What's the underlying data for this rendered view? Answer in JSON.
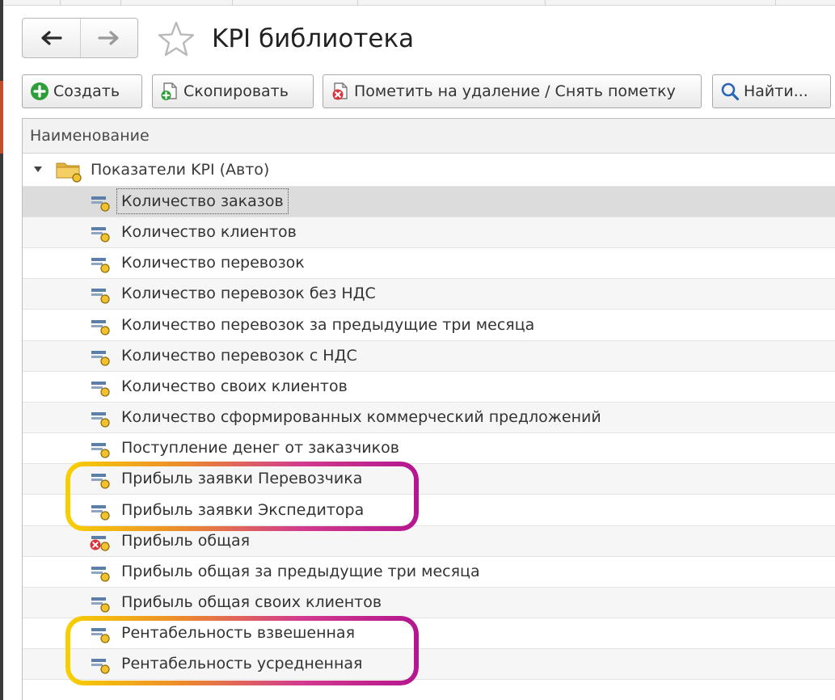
{
  "window": {
    "title": "KPI библиотека",
    "favorite_icon": "star-outline-icon",
    "nav": {
      "back_icon": "arrow-left-icon",
      "forward_icon": "arrow-right-icon"
    }
  },
  "toolbar": {
    "create_label": "Создать",
    "create_icon": "plus-circle-icon",
    "copy_label": "Скопировать",
    "copy_icon": "copy-document-icon",
    "mark_delete_label": "Пометить на удаление / Снять пометку",
    "mark_delete_icon": "delete-mark-icon",
    "find_label": "Найти..."
  },
  "table": {
    "column_name": "Наименование",
    "group": {
      "label": "Показатели KPI (Авто)",
      "icon": "folder-icon",
      "expanded": true
    },
    "items": [
      {
        "label": "Количество заказов",
        "selected": true,
        "marked_for_deletion": false
      },
      {
        "label": "Количество клиентов",
        "selected": false,
        "marked_for_deletion": false
      },
      {
        "label": "Количество перевозок",
        "selected": false,
        "marked_for_deletion": false
      },
      {
        "label": "Количество перевозок без НДС",
        "selected": false,
        "marked_for_deletion": false
      },
      {
        "label": "Количество перевозок за предыдущие три месяца",
        "selected": false,
        "marked_for_deletion": false
      },
      {
        "label": "Количество перевозок с НДС",
        "selected": false,
        "marked_for_deletion": false
      },
      {
        "label": "Количество своих клиентов",
        "selected": false,
        "marked_for_deletion": false
      },
      {
        "label": "Количество сформированных коммерческий предложений",
        "selected": false,
        "marked_for_deletion": false
      },
      {
        "label": "Поступление денег от заказчиков",
        "selected": false,
        "marked_for_deletion": false
      },
      {
        "label": "Прибыль заявки Перевозчика",
        "selected": false,
        "marked_for_deletion": false,
        "highlighted": true
      },
      {
        "label": "Прибыль заявки Экспедитора",
        "selected": false,
        "marked_for_deletion": false,
        "highlighted": true
      },
      {
        "label": "Прибыль общая",
        "selected": false,
        "marked_for_deletion": true
      },
      {
        "label": "Прибыль общая за предыдущие три месяца",
        "selected": false,
        "marked_for_deletion": false
      },
      {
        "label": "Прибыль общая своих клиентов",
        "selected": false,
        "marked_for_deletion": false
      },
      {
        "label": "Рентабельность взвешенная",
        "selected": false,
        "marked_for_deletion": false,
        "highlighted": true
      },
      {
        "label": "Рентабельность усредненная",
        "selected": false,
        "marked_for_deletion": false,
        "highlighted": true
      }
    ]
  },
  "colors": {
    "highlight_gradient": [
      "#f7d000",
      "#ec8a2e",
      "#d23b8e",
      "#b4168f"
    ],
    "selected_row": "#dcdcdc",
    "create_green": "#2e9e3a",
    "delete_red": "#d8343a"
  }
}
